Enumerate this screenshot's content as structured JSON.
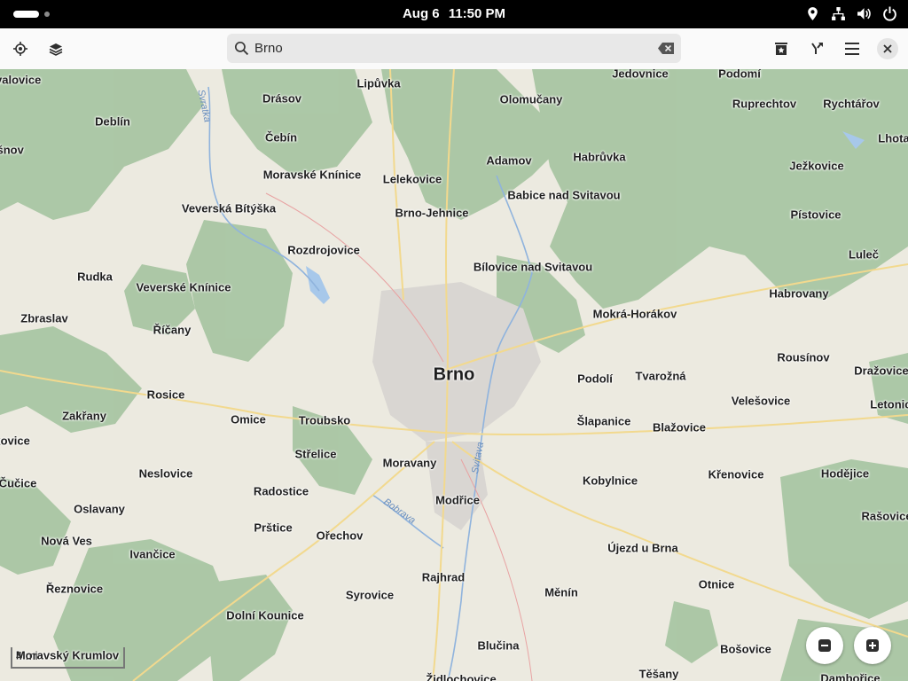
{
  "system_bar": {
    "date": "Aug 6",
    "time": "11:50 PM",
    "tray_icons": [
      "location-icon",
      "network-icon",
      "volume-icon",
      "power-icon"
    ]
  },
  "header": {
    "search_value": "Brno",
    "left_buttons": [
      "my-location-icon",
      "layers-icon"
    ],
    "right_buttons": [
      "favorites-icon",
      "route-icon",
      "menu-icon",
      "close-icon"
    ]
  },
  "map": {
    "center": "Brno",
    "scale_label": "4 mi",
    "rivers": [
      "Svratka",
      "Svitava",
      "Bobrava"
    ],
    "places": [
      "Brno",
      "Lipůvka",
      "Jedovnice",
      "Podomí",
      "Drásov",
      "Olomučany",
      "Ruprechtov",
      "Rychtářov",
      "Deblín",
      "Čebín",
      "Adamov",
      "Habrůvka",
      "Lhota",
      "Ježkovice",
      "Moravské Knínice",
      "Lelekovice",
      "Babice nad Svitavou",
      "Veverská Bítýška",
      "Brno-Jehnice",
      "Pístovice",
      "Rozdrojovice",
      "Luleč",
      "Rudka",
      "Bílovice nad Svitavou",
      "Veverské Knínice",
      "Habrovany",
      "Zbraslav",
      "Mokrá-Horákov",
      "Říčany",
      "Rousínov",
      "Dražovice",
      "Podolí",
      "Tvarožná",
      "Rosice",
      "Velešovice",
      "Letonice",
      "Zakřany",
      "Omice",
      "Troubsko",
      "Šlapanice",
      "Blažovice",
      "Střelice",
      "Moravany",
      "Neslovice",
      "Kobylnice",
      "Křenovice",
      "Hodějice",
      "Radostice",
      "Modřice",
      "Oslavany",
      "Rašovice",
      "Prštice",
      "Ořechov",
      "Nová Ves",
      "Ivančice",
      "Újezd u Brna",
      "Řeznovice",
      "Rajhrad",
      "Otnice",
      "Syrovice",
      "Měnín",
      "Dolní Kounice",
      "Moravský Krumlov",
      "Blučina",
      "Bošovice",
      "Těšany",
      "Židlochovice",
      "Dambořice",
      "Kovalovice",
      "Čučice",
      "Zakovice",
      "Tišnov"
    ]
  },
  "colors": {
    "forest": "#a9c6a3",
    "land": "#eceae0",
    "urban": "#d9d6d2",
    "water": "#a7c8ea",
    "road": "#f2d98e"
  }
}
